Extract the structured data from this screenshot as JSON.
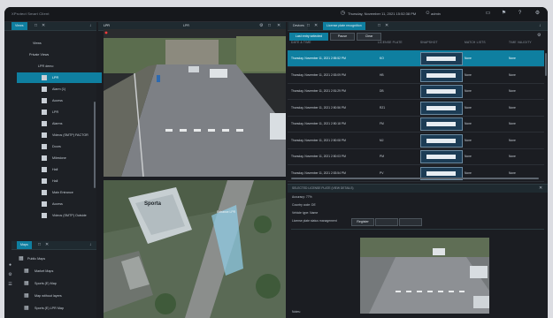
{
  "app": {
    "brand": "XProtect Smart Client",
    "datetime": "Thursday, November 11, 2021 15:52:38 PM",
    "user": "admin"
  },
  "left": {
    "views_tab": "Views",
    "tree": [
      {
        "label": "Views",
        "kind": "header"
      },
      {
        "label": "Private Views",
        "kind": "group"
      },
      {
        "label": "LPR demo",
        "kind": "folder"
      },
      {
        "label": "LPR",
        "kind": "view",
        "selected": true
      },
      {
        "label": "Alarm (1)",
        "kind": "view"
      },
      {
        "label": "Access",
        "kind": "view"
      },
      {
        "label": "LPR",
        "kind": "view"
      },
      {
        "label": "Alarms",
        "kind": "view"
      },
      {
        "label": "Videos (SMTP) FACTOR",
        "kind": "view"
      },
      {
        "label": "Doors",
        "kind": "view"
      },
      {
        "label": "Milestone",
        "kind": "view"
      },
      {
        "label": "Hall",
        "kind": "view"
      },
      {
        "label": "Hall",
        "kind": "view"
      },
      {
        "label": "Main Entrance",
        "kind": "view"
      },
      {
        "label": "Access",
        "kind": "view"
      },
      {
        "label": "Videos (SMTP) Outside",
        "kind": "view"
      }
    ],
    "maps_tab": "Maps",
    "maps": [
      {
        "label": "Public Maps",
        "kind": "group"
      },
      {
        "label": "Market Maps",
        "kind": "map"
      },
      {
        "label": "Sports (E) Map",
        "kind": "map"
      },
      {
        "label": "Map without layers",
        "kind": "map"
      },
      {
        "label": "Sports (E) LPR Map",
        "kind": "map"
      }
    ]
  },
  "camera": {
    "tab_label": "LPR",
    "camera_label": "LPR"
  },
  "map_view": {
    "building_label": "Sporta",
    "camera_label": "Entrance LPR"
  },
  "right": {
    "tabs": [
      "Devices",
      "License plate recognition"
    ],
    "buttons": {
      "last_entry": "Last entry selected",
      "pause": "Pause",
      "clear": "Clear"
    },
    "columns": [
      "DATE & TIME",
      "LICENSE PLATE",
      "SNAPSHOT",
      "MATCH LISTS",
      "TIME VALIDITY"
    ],
    "rows": [
      {
        "datetime": "Thursday, November 11, 2021 2:55:52 PM",
        "plate": "KO",
        "list": "None",
        "validity": "None",
        "selected": true
      },
      {
        "datetime": "Thursday, November 11, 2021 2:53:09 PM",
        "plate": "HB",
        "list": "None",
        "validity": "None"
      },
      {
        "datetime": "Thursday, November 11, 2021 2:51:29 PM",
        "plate": "DB",
        "list": "None",
        "validity": "None"
      },
      {
        "datetime": "Thursday, November 11, 2021 2:50:56 PM",
        "plate": "RZ1",
        "list": "None",
        "validity": "None"
      },
      {
        "datetime": "Thursday, November 11, 2021 2:50:18 PM",
        "plate": "FM",
        "list": "None",
        "validity": "None"
      },
      {
        "datetime": "Thursday, November 11, 2021 2:50:08 PM",
        "plate": "MJ",
        "list": "None",
        "validity": "None"
      },
      {
        "datetime": "Thursday, November 11, 2021 2:50:03 PM",
        "plate": "PM",
        "list": "None",
        "validity": "None"
      },
      {
        "datetime": "Thursday, November 11, 2021 2:53:54 PM",
        "plate": "PV",
        "list": "None",
        "validity": "None"
      }
    ],
    "details_header": "SELECTED LICENSE PLATE (VIEW DETAILS)",
    "details": {
      "accuracy": "Accuracy: 77%",
      "country": "Country code: DE",
      "vehicle": "Vehicle type: Name",
      "match_list": "License plate status management",
      "register_btn": "Register",
      "notes": "Notes:"
    }
  },
  "colors": {
    "accent": "#0f7fa0",
    "bg": "#1b1d22",
    "panel": "#1d2025"
  }
}
